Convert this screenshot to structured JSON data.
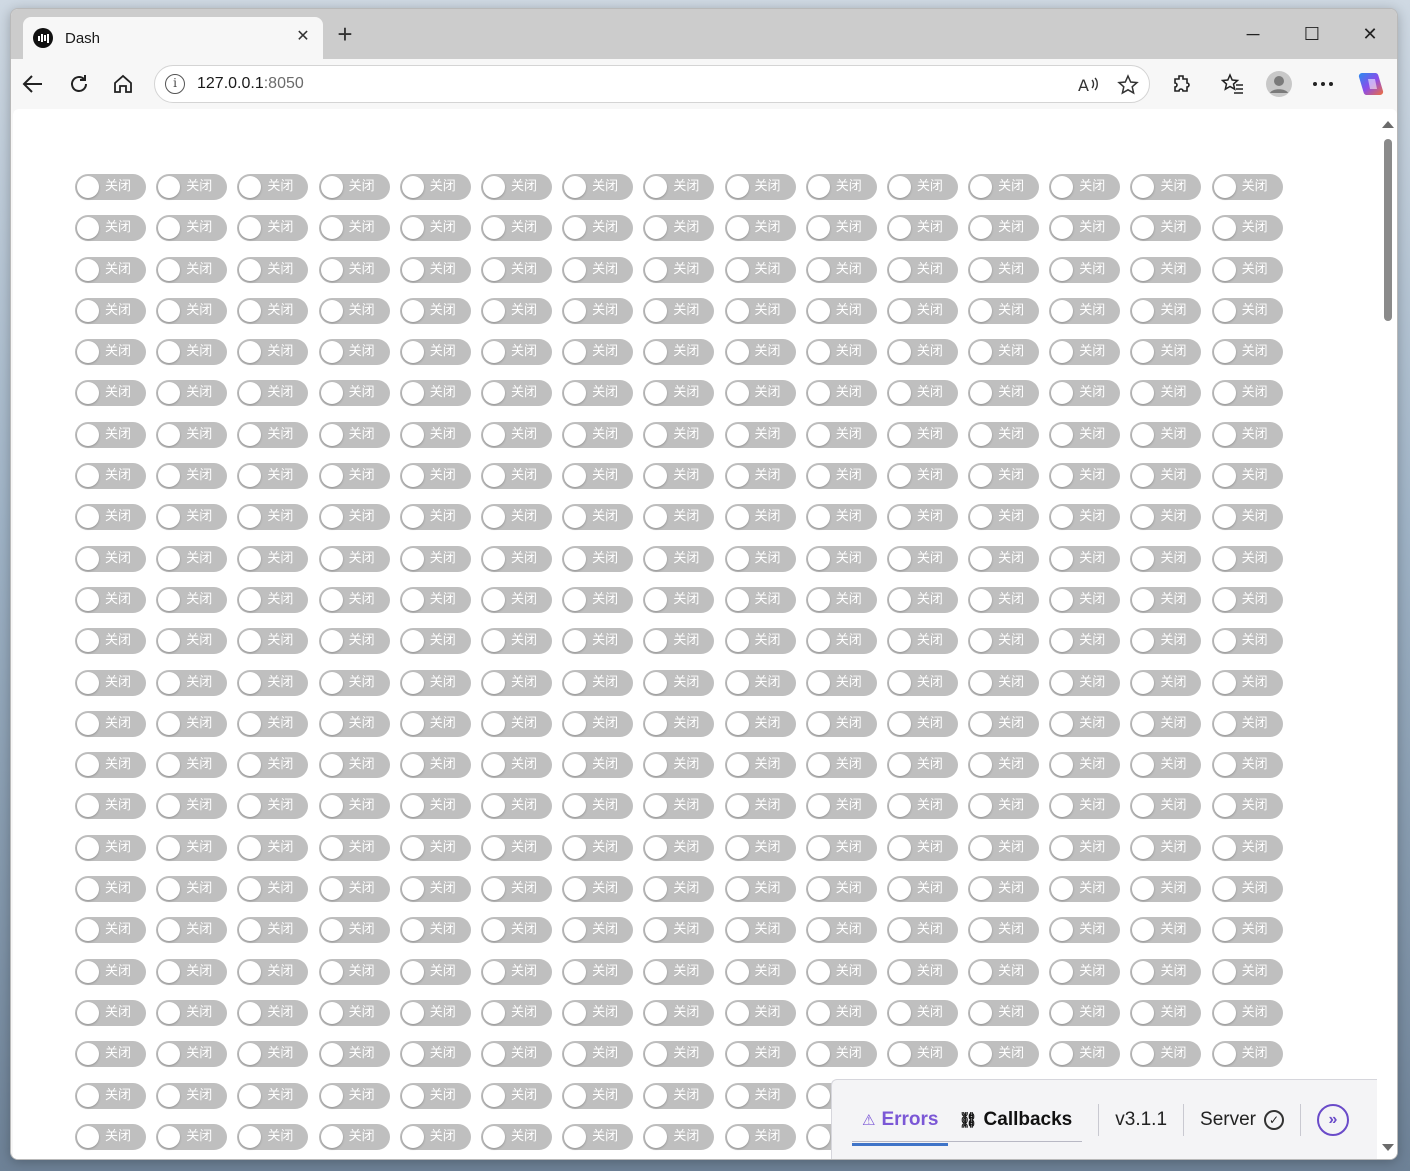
{
  "browser": {
    "tab_title": "Dash",
    "url_host": "127.0.0.1",
    "url_port": ":8050"
  },
  "switches": {
    "rows": 24,
    "cols": 15,
    "label": "关闭",
    "state": "off",
    "color_off": "#bfbfbf"
  },
  "devtools": {
    "errors_label": "Errors",
    "callbacks_label": "Callbacks",
    "version": "v3.1.1",
    "server_label": "Server"
  },
  "icons": [
    "dash-favicon",
    "close-icon",
    "plus-icon",
    "minimize-icon",
    "maximize-icon",
    "window-close-icon",
    "back-arrow-icon",
    "reload-icon",
    "home-icon",
    "info-icon",
    "read-aloud-icon",
    "favorite-star-icon",
    "extensions-icon",
    "favorites-icon",
    "profile-avatar",
    "more-icon",
    "copilot-icon",
    "warning-icon",
    "callbacks-icon",
    "check-circle-icon",
    "expand-icon"
  ]
}
